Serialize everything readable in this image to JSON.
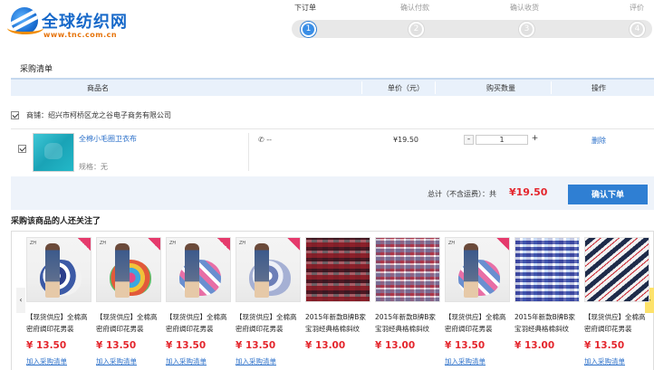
{
  "header": {
    "logo_text": "全球纺织网",
    "logo_url": "www.tnc.com.cn"
  },
  "steps": [
    {
      "label": "下订单",
      "number": "1",
      "active": true
    },
    {
      "label": "确认付款",
      "number": "2",
      "active": false
    },
    {
      "label": "确认收货",
      "number": "3",
      "active": false
    },
    {
      "label": "评价",
      "number": "4",
      "active": false
    }
  ],
  "cart": {
    "title": "采购清单",
    "columns": [
      "商品名",
      "单价（元）",
      "购买数量",
      "操作"
    ],
    "shop_label": "商铺：",
    "shop_name": "绍兴市柯桥区龙之谷电子商务有限公司",
    "item": {
      "title": "全棉小毛圈卫衣布",
      "spec": "规格：无",
      "phone": "--",
      "price": "¥19.50",
      "qty_minus": "-",
      "qty_value": "1",
      "qty_plus": "+",
      "delete_label": "删除"
    },
    "total_label": "总计（不含运费）：共",
    "total_value": "¥19.50",
    "submit_label": "确认下单"
  },
  "recommend": {
    "title": "采购该商品的人还关注了",
    "add_label": "加入采购清单",
    "items": [
      {
        "name": "【现货供应】全棉高密府绸印花男装",
        "price": "¥ 13.50",
        "image": "dress-umbrella-navy"
      },
      {
        "name": "【现货供应】全棉高密府绸印花男装",
        "price": "¥ 13.50",
        "image": "dress-umbrella-multicolor"
      },
      {
        "name": "【现货供应】全棉高密府绸印花男装",
        "price": "¥ 13.50",
        "image": "dress-umbrella-pink-stripe"
      },
      {
        "name": "【现货供应】全棉高密府绸印花男装",
        "price": "¥ 13.50",
        "image": "dress-umbrella-blue"
      },
      {
        "name": "2015年新款B牌B家宝羽经典格棉斜纹",
        "price": "¥ 13.00",
        "image": "plaid-red"
      },
      {
        "name": "2015年新款B牌B家宝羽经典格棉斜纹",
        "price": "¥ 13.00",
        "image": "plaid-purple"
      },
      {
        "name": "【现货供应】全棉高密府绸印花男装",
        "price": "¥ 13.50",
        "image": "dress-umbrella-pink"
      },
      {
        "name": "2015年新款B牌B家宝羽经典格棉斜纹",
        "price": "¥ 13.00",
        "image": "plaid-blue"
      },
      {
        "name": "【现货供应】全棉高密府绸印花男装",
        "price": "¥ 13.50",
        "image": "stripe-navy"
      }
    ]
  },
  "colors": {
    "accent": "#2f7fd3",
    "price": "#e4262d",
    "link": "#2a6fc9"
  }
}
